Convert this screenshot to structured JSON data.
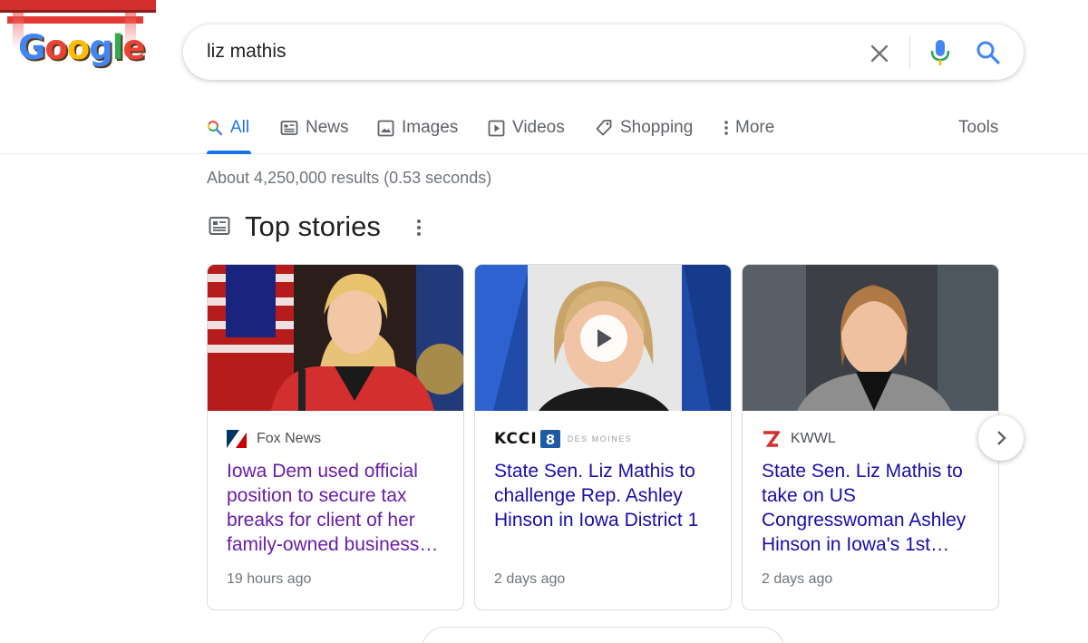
{
  "doodle": {
    "alt": "Google"
  },
  "search": {
    "query": "liz mathis"
  },
  "tabs": [
    {
      "label": "All",
      "icon": "search-icon",
      "active": true
    },
    {
      "label": "News",
      "icon": "news-icon"
    },
    {
      "label": "Images",
      "icon": "image-icon"
    },
    {
      "label": "Videos",
      "icon": "video-icon"
    },
    {
      "label": "Shopping",
      "icon": "tag-icon"
    },
    {
      "label": "More",
      "icon": "more-vert-icon"
    }
  ],
  "tools_label": "Tools",
  "result_stats": "About 4,250,000 results (0.53 seconds)",
  "top_stories": {
    "title": "Top stories",
    "cards": [
      {
        "source": "Fox News",
        "headline": "Iowa Dem used official position to secure tax breaks for client of her family-owned business…",
        "age": "19 hours ago",
        "visited": true
      },
      {
        "source": "KCCI",
        "source_sub": "DES MOINES",
        "headline": "State Sen. Liz Mathis to challenge Rep. Ashley Hinson in Iowa District 1",
        "age": "2 days ago",
        "has_video": true
      },
      {
        "source": "KWWL",
        "headline": "State Sen. Liz Mathis to take on US Congresswoman Ashley Hinson in Iowa's 1st…",
        "age": "2 days ago"
      }
    ]
  },
  "colors": {
    "accent": "#1a73e8",
    "link": "#1a0dab",
    "visited": "#681da8",
    "muted": "#70757a"
  }
}
